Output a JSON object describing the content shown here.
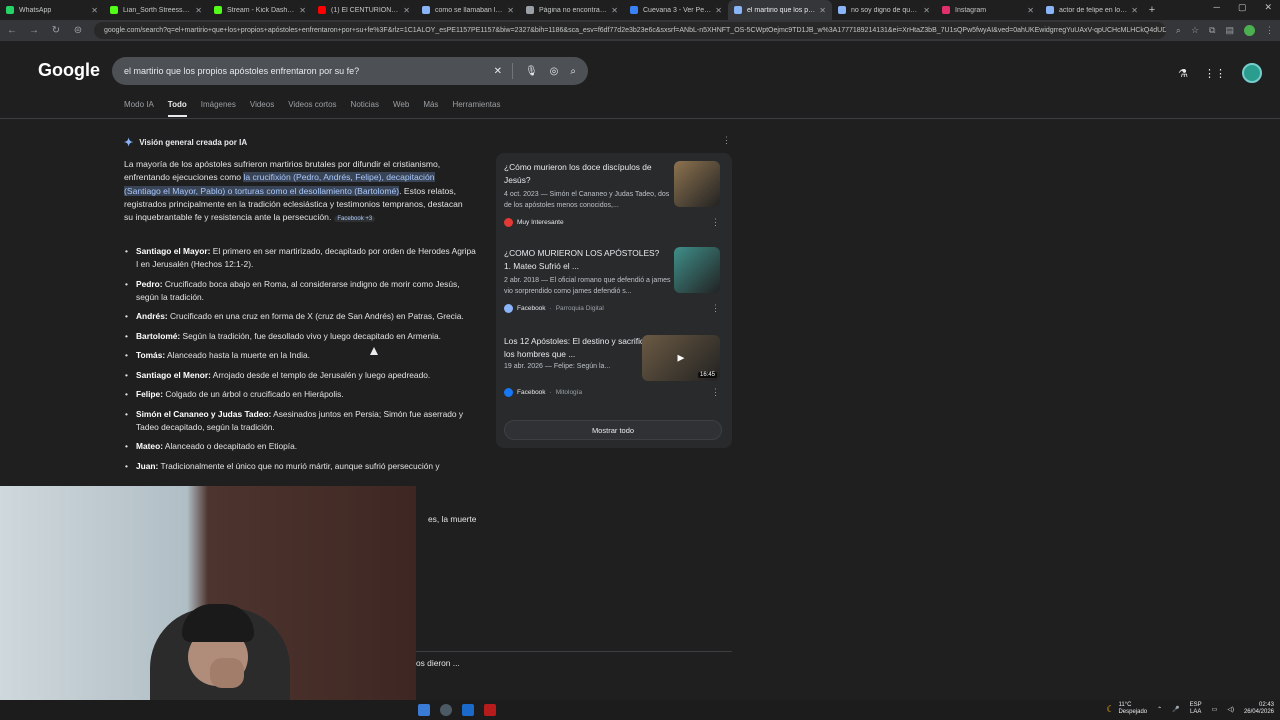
{
  "browser": {
    "tabs": [
      {
        "label": "WhatsApp",
        "color": "#25d366"
      },
      {
        "label": "Lian_Sorth Streess - Watch",
        "color": "#53fc18"
      },
      {
        "label": "Stream - Kick Dashboard",
        "color": "#53fc18"
      },
      {
        "label": "(1) El CENTURIÓN ROMANO",
        "color": "#ff0000"
      },
      {
        "label": "como se llamaban los apóstoles",
        "color": "#8ab4f8"
      },
      {
        "label": "Página no encontrada",
        "color": "#9aa0a6"
      },
      {
        "label": "Cuevana 3 - Ver Películas",
        "color": "#3b82f6"
      },
      {
        "label": "el martirio que los propios",
        "color": "#8ab4f8"
      },
      {
        "label": "no soy digno de que entres",
        "color": "#8ab4f8"
      },
      {
        "label": "Instagram",
        "color": "#e1306c"
      },
      {
        "label": "actor de felipe en los elegidos",
        "color": "#8ab4f8"
      }
    ],
    "active_tab_index": 7,
    "new_tab": "+",
    "url": "google.com/search?q=el+martirio+que+los+propios+apóstoles+enfrentaron+por+su+fe%3F&rlz=1C1ALOY_esPE1157PE1157&biw=2327&bih=1186&sca_esv=f6df77d2e3b23e6c&sxsrf=ANbL-n5XHNFT_OS-5CWptOejmc9TD1JB_w%3A1777189214131&ei=XrHtaZ3bB_7U1sQPw5fwyAI&ved=0ahUKEwidgrregYuUAxV-qpUCHcMLHCkQ4dUDCBE&uact=5&oq=el+martirio+que+los+propios"
  },
  "google": {
    "logo": "Google",
    "query": "el martirio que los propios apóstoles enfrentaron por su fe?",
    "filters": [
      "Modo IA",
      "Todo",
      "Imágenes",
      "Videos",
      "Videos cortos",
      "Noticias",
      "Web",
      "Más",
      "Herramientas"
    ],
    "active_filter": "Todo"
  },
  "ai_overview": {
    "heading": "Visión general creada por IA",
    "para_a": "La mayoría de los apóstoles sufrieron martirios brutales por difundir el cristianismo, enfrentando ejecuciones como ",
    "para_highlight": "la crucifixión (Pedro, Andrés, Felipe), decapitación (Santiago el Mayor, Pablo) o torturas como el desollamiento (Bartolomé)",
    "para_b": ". Estos relatos, registrados principalmente en la tradición eclesiástica y testimonios tempranos, destacan su inquebrantable fe y resistencia ante la persecución.",
    "source_chip": "Facebook +3",
    "items": [
      {
        "name": "Santiago el Mayor:",
        "text": " El primero en ser martirizado, decapitado por orden de Herodes Agripa I en Jerusalén (Hechos 12:1-2)."
      },
      {
        "name": "Pedro:",
        "text": " Crucificado boca abajo en Roma, al considerarse indigno de morir como Jesús, según la tradición."
      },
      {
        "name": "Andrés:",
        "text": " Crucificado en una cruz en forma de X (cruz de San Andrés) en Patras, Grecia."
      },
      {
        "name": "Bartolomé:",
        "text": " Según la tradición, fue desollado vivo y luego decapitado en Armenia."
      },
      {
        "name": "Tomás:",
        "text": " Alanceado hasta la muerte en la India."
      },
      {
        "name": "Santiago el Menor:",
        "text": " Arrojado desde el templo de Jerusalén y luego apedreado."
      },
      {
        "name": "Felipe:",
        "text": " Colgado de un árbol o crucificado en Hierápolis."
      },
      {
        "name": "Simón el Cananeo y Judas Tadeo:",
        "text": " Asesinados juntos en Persia; Simón fue aserrado y Tadeo decapitado, según la tradición."
      },
      {
        "name": "Mateo:",
        "text": " Alanceado o decapitado en Etiopía."
      },
      {
        "name": "Juan:",
        "text": " Tradicionalmente el único que no murió mártir, aunque sufrió persecución y"
      }
    ],
    "fragment_1": "es, la muerte",
    "fragment_2": "os dieron ..."
  },
  "side_cards": [
    {
      "title": "¿Cómo murieron los doce discípulos de Jesús?",
      "snippet": "4 oct. 2023 — Simón el Cananeo y Judas Tadeo, dos de los apóstoles menos conocidos,...",
      "source": "Muy Interesante",
      "sub": "",
      "dot_color": "#e53935",
      "thumb_color": "#8d7350"
    },
    {
      "title": "¿COMO MURIERON LOS APÓSTOLES? 1. Mateo Sufrió el ...",
      "snippet": "2 abr. 2018 — El oficial romano que defendió a james vio sorprendido como james defendió s...",
      "source": "Facebook",
      "sub": "Parroquia Digital",
      "dot_color": "#8ab4f8",
      "thumb_color": "#3f8f8a"
    },
    {
      "title": "Los 12 Apóstoles: El destino y sacrificio de los hombres que ...",
      "snippet": "19 abr. 2026 — Felipe: Según la...",
      "source": "Facebook",
      "sub": "Mitología",
      "dot_color": "#1877f2",
      "thumb_color": "#6b5a44",
      "duration": "16:45"
    }
  ],
  "show_all": "Mostrar todo",
  "taskbar": {
    "weather_temp": "11°C",
    "weather_desc": "Despejado",
    "lang_1": "ESP",
    "lang_2": "LAA",
    "time": "02:43",
    "date": "26/04/2026"
  }
}
